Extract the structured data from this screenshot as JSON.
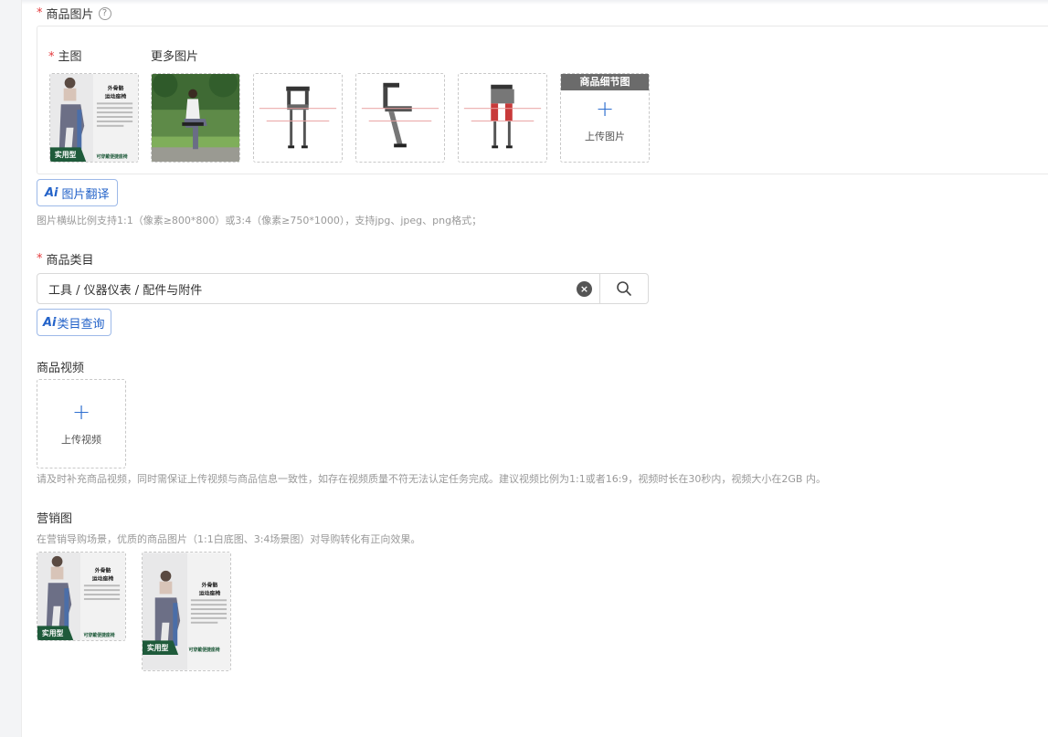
{
  "product_images": {
    "required_mark": "*",
    "label": "商品图片",
    "help_glyph": "?",
    "main_label": "主图",
    "more_label": "更多图片",
    "detail_header": "商品细节图",
    "upload_plus": "+",
    "upload_text": "上传图片",
    "main_thumb": {
      "headline1": "外骨骼",
      "headline2": "运动座椅",
      "badge": "实用型",
      "tagline": "可穿戴便捷座椅"
    }
  },
  "ai_translate": {
    "logo": "Ai",
    "label": "图片翻译"
  },
  "image_hint": "图片横纵比例支持1:1（像素≥800*800）或3:4（像素≥750*1000），支持jpg、jpeg、png格式；",
  "category": {
    "required_mark": "*",
    "label": "商品类目",
    "value": "工具 / 仪器仪表 / 配件与附件",
    "clear_glyph": "×"
  },
  "ai_category": {
    "logo": "Ai",
    "label": "类目查询"
  },
  "video": {
    "label": "商品视频",
    "upload_plus": "+",
    "upload_text": "上传视频",
    "hint": "请及时补充商品视频，同时需保证上传视频与商品信息一致性，如存在视频质量不符无法认定任务完成。建议视频比例为1:1或者16:9，视频时长在30秒内，视频大小在2GB 内。"
  },
  "marketing": {
    "label": "营销图",
    "hint": "在营销导购场景，优质的商品图片（1:1白底图、3:4场景图）对导购转化有正向效果。",
    "thumb1": {
      "headline1": "外骨骼",
      "headline2": "运动座椅",
      "badge": "实用型",
      "tagline": "可穿戴便捷座椅"
    },
    "thumb2": {
      "headline1": "外骨骼",
      "headline2": "运动座椅",
      "badge": "实用型",
      "tagline": "可穿戴便捷座椅"
    }
  },
  "colors": {
    "accent": "#2463c9",
    "required": "#e4393c",
    "badge_green": "#1e5a3a"
  }
}
